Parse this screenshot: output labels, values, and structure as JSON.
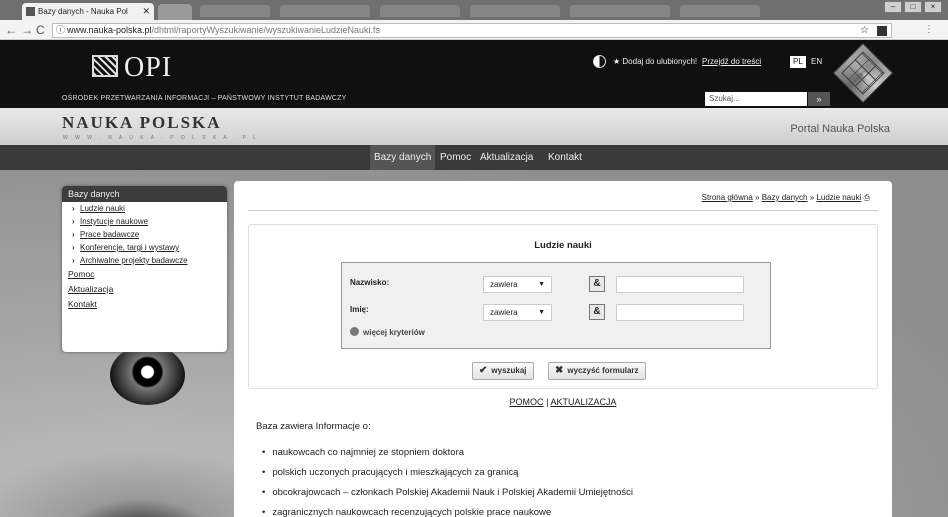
{
  "browser": {
    "tab_title": "Bazy danych - Nauka Pol",
    "url_main": "www.nauka-polska.pl",
    "url_path": "/dhtml/raportyWyszukiwanie/wyszukiwanieLudzieNauki.fs",
    "back": "←",
    "forward": "→",
    "reload": "C",
    "win_min": "–",
    "win_max": "□",
    "win_close": "×"
  },
  "header": {
    "logo": "OPI",
    "tagline": "OŚRODEK PRZETWARZANIA INFORMACJI – PAŃSTWOWY INSTYTUT BADAWCZY",
    "favorite": "★ Dodaj do ulubionych!",
    "skip": "Przejdź do treści",
    "lang_pl": "PL",
    "lang_en": "EN",
    "search_placeholder": "Szukaj...",
    "search_btn": "»"
  },
  "site": {
    "name": "NAUKA POLSKA",
    "domain": "W W W . N A U K A - P O L S K A . P L",
    "portal": "Portal Nauka Polska"
  },
  "menu": [
    "Bazy danych",
    "Pomoc",
    "Aktualizacja",
    "Kontakt"
  ],
  "sidebar": {
    "title": "Bazy danych",
    "sub_items": [
      "Ludzie nauki",
      "Instytucje naukowe",
      "Prace badawcze",
      "Konferencje, targi i wystawy",
      "Archiwalne projekty badawcze"
    ],
    "top_items": [
      "Pomoc",
      "Aktualizacja",
      "Kontakt"
    ]
  },
  "breadcrumb": {
    "home": "Strona główna",
    "sep": "»",
    "section": "Bazy danych",
    "current": "Ludzie nauki"
  },
  "form": {
    "title": "Ludzie nauki",
    "surname_label": "Nazwisko:",
    "surname_op": "zawiera",
    "name_label": "Imię:",
    "name_op": "zawiera",
    "amp": "&",
    "more": "więcej kryteriów",
    "search_btn": "wyszukaj",
    "clear_btn": "wyczyść formularz"
  },
  "links": {
    "help": "POMOC",
    "sep": "|",
    "update": "AKTUALIZACJA"
  },
  "intro": "Baza zawiera Informacje o:",
  "bullets": [
    "naukowcach co najmniej ze stopniem doktora",
    "polskich uczonych pracujących i mieszkających za granicą",
    "obcokrajowcach – członkach Polskiej Akademii Nauk i Polskiej Akademii Umiejętności",
    "zagranicznych naukowcach recenzujących polskie prace naukowe"
  ]
}
